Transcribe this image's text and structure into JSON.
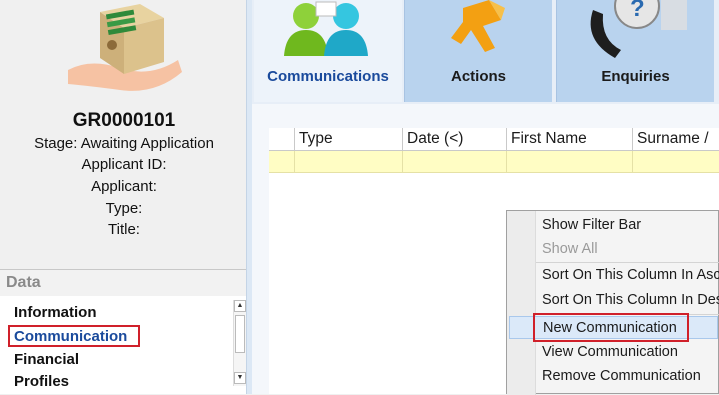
{
  "record": {
    "id": "GR0000101",
    "stage": "Stage: Awaiting Application",
    "applicant_id": "Applicant ID:",
    "applicant": "Applicant:",
    "type": "Type:",
    "title": "Title:"
  },
  "sidebar": {
    "header": "Data",
    "items": [
      {
        "label": "Information"
      },
      {
        "label": "Communication"
      },
      {
        "label": "Financial"
      },
      {
        "label": "Profiles"
      }
    ],
    "selected": "Communication"
  },
  "toolbar": {
    "tabs": [
      {
        "label": "Communications",
        "icon": "people-icon"
      },
      {
        "label": "Actions",
        "icon": "running-man-icon"
      },
      {
        "label": "Enquiries",
        "icon": "phone-help-icon"
      }
    ]
  },
  "grid": {
    "columns": [
      "",
      "Type",
      "Date (<)",
      "First Name",
      "Surname /"
    ]
  },
  "context_menu": {
    "items": [
      {
        "label": "Show Filter Bar",
        "enabled": true
      },
      {
        "label": "Show All",
        "enabled": false
      },
      {
        "label": "Sort On This Column In Asc",
        "enabled": true
      },
      {
        "label": "Sort On This Column In Des",
        "enabled": true
      },
      {
        "label": "New Communication",
        "enabled": true,
        "highlighted": true
      },
      {
        "label": "View Communication",
        "enabled": true
      },
      {
        "label": "Remove Communication",
        "enabled": true
      }
    ]
  },
  "colors": {
    "highlight_box": "#d0202a",
    "filter_row": "#fffdc4",
    "tab_active": "#edf3fa",
    "tab_inactive": "#b9d3ee"
  }
}
